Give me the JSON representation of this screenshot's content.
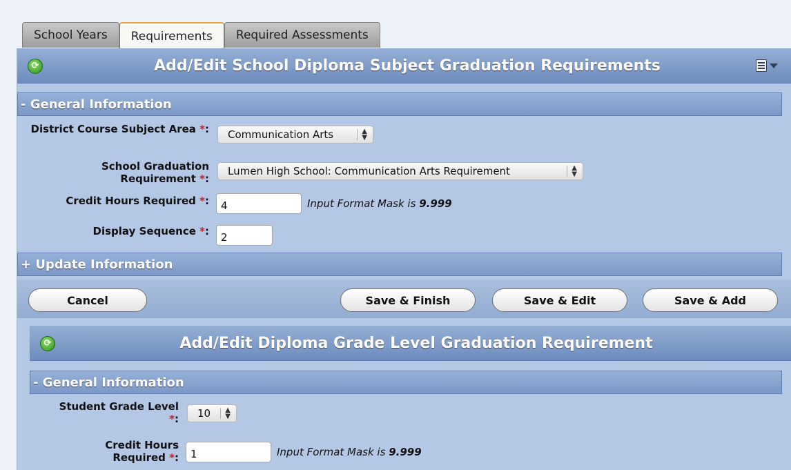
{
  "tabs": [
    "School Years",
    "Requirements",
    "Required Assessments"
  ],
  "panel": {
    "title": "Add/Edit School Diploma Subject Graduation Requirements",
    "general_section": "- General Information",
    "update_section": "+ Update Information",
    "fields": {
      "subject_area_label": "District Course Subject Area",
      "subject_area_value": "Communication Arts",
      "grad_req_label": "School Graduation Requirement",
      "grad_req_value": "Lumen High School: Communication Arts Requirement",
      "credit_hours_label": "Credit Hours Required",
      "credit_hours_value": "4",
      "display_seq_label": "Display Sequence",
      "display_seq_value": "2"
    },
    "mask_text": "Input Format Mask is",
    "mask_value": "9.999",
    "required_marker": "*",
    "colon": ":",
    "buttons": {
      "cancel": "Cancel",
      "save_finish": "Save & Finish",
      "save_edit": "Save & Edit",
      "save_add": "Save & Add"
    }
  },
  "subpanel": {
    "title": "Add/Edit Diploma Grade Level Graduation Requirement",
    "general_section": "- General Information",
    "grade_label": "Student Grade Level",
    "grade_value": "10",
    "credit_label": "Credit Hours Required",
    "credit_value": "1"
  },
  "colors": {
    "header_blue": "#6d8cbd",
    "panel_bg": "#b4c8e6",
    "required": "#e0161b"
  }
}
